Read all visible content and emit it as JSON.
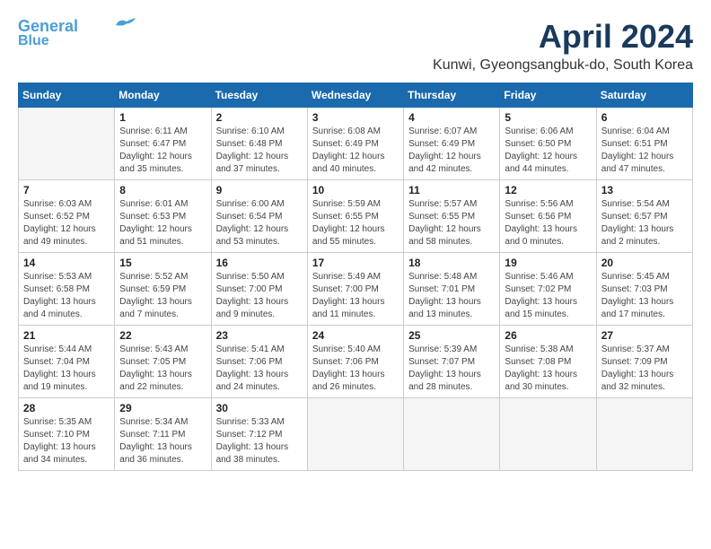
{
  "header": {
    "logo_line1": "General",
    "logo_line2": "Blue",
    "month_title": "April 2024",
    "subtitle": "Kunwi, Gyeongsangbuk-do, South Korea"
  },
  "weekdays": [
    "Sunday",
    "Monday",
    "Tuesday",
    "Wednesday",
    "Thursday",
    "Friday",
    "Saturday"
  ],
  "weeks": [
    [
      {
        "day": "",
        "info": ""
      },
      {
        "day": "1",
        "info": "Sunrise: 6:11 AM\nSunset: 6:47 PM\nDaylight: 12 hours\nand 35 minutes."
      },
      {
        "day": "2",
        "info": "Sunrise: 6:10 AM\nSunset: 6:48 PM\nDaylight: 12 hours\nand 37 minutes."
      },
      {
        "day": "3",
        "info": "Sunrise: 6:08 AM\nSunset: 6:49 PM\nDaylight: 12 hours\nand 40 minutes."
      },
      {
        "day": "4",
        "info": "Sunrise: 6:07 AM\nSunset: 6:49 PM\nDaylight: 12 hours\nand 42 minutes."
      },
      {
        "day": "5",
        "info": "Sunrise: 6:06 AM\nSunset: 6:50 PM\nDaylight: 12 hours\nand 44 minutes."
      },
      {
        "day": "6",
        "info": "Sunrise: 6:04 AM\nSunset: 6:51 PM\nDaylight: 12 hours\nand 47 minutes."
      }
    ],
    [
      {
        "day": "7",
        "info": "Sunrise: 6:03 AM\nSunset: 6:52 PM\nDaylight: 12 hours\nand 49 minutes."
      },
      {
        "day": "8",
        "info": "Sunrise: 6:01 AM\nSunset: 6:53 PM\nDaylight: 12 hours\nand 51 minutes."
      },
      {
        "day": "9",
        "info": "Sunrise: 6:00 AM\nSunset: 6:54 PM\nDaylight: 12 hours\nand 53 minutes."
      },
      {
        "day": "10",
        "info": "Sunrise: 5:59 AM\nSunset: 6:55 PM\nDaylight: 12 hours\nand 55 minutes."
      },
      {
        "day": "11",
        "info": "Sunrise: 5:57 AM\nSunset: 6:55 PM\nDaylight: 12 hours\nand 58 minutes."
      },
      {
        "day": "12",
        "info": "Sunrise: 5:56 AM\nSunset: 6:56 PM\nDaylight: 13 hours\nand 0 minutes."
      },
      {
        "day": "13",
        "info": "Sunrise: 5:54 AM\nSunset: 6:57 PM\nDaylight: 13 hours\nand 2 minutes."
      }
    ],
    [
      {
        "day": "14",
        "info": "Sunrise: 5:53 AM\nSunset: 6:58 PM\nDaylight: 13 hours\nand 4 minutes."
      },
      {
        "day": "15",
        "info": "Sunrise: 5:52 AM\nSunset: 6:59 PM\nDaylight: 13 hours\nand 7 minutes."
      },
      {
        "day": "16",
        "info": "Sunrise: 5:50 AM\nSunset: 7:00 PM\nDaylight: 13 hours\nand 9 minutes."
      },
      {
        "day": "17",
        "info": "Sunrise: 5:49 AM\nSunset: 7:00 PM\nDaylight: 13 hours\nand 11 minutes."
      },
      {
        "day": "18",
        "info": "Sunrise: 5:48 AM\nSunset: 7:01 PM\nDaylight: 13 hours\nand 13 minutes."
      },
      {
        "day": "19",
        "info": "Sunrise: 5:46 AM\nSunset: 7:02 PM\nDaylight: 13 hours\nand 15 minutes."
      },
      {
        "day": "20",
        "info": "Sunrise: 5:45 AM\nSunset: 7:03 PM\nDaylight: 13 hours\nand 17 minutes."
      }
    ],
    [
      {
        "day": "21",
        "info": "Sunrise: 5:44 AM\nSunset: 7:04 PM\nDaylight: 13 hours\nand 19 minutes."
      },
      {
        "day": "22",
        "info": "Sunrise: 5:43 AM\nSunset: 7:05 PM\nDaylight: 13 hours\nand 22 minutes."
      },
      {
        "day": "23",
        "info": "Sunrise: 5:41 AM\nSunset: 7:06 PM\nDaylight: 13 hours\nand 24 minutes."
      },
      {
        "day": "24",
        "info": "Sunrise: 5:40 AM\nSunset: 7:06 PM\nDaylight: 13 hours\nand 26 minutes."
      },
      {
        "day": "25",
        "info": "Sunrise: 5:39 AM\nSunset: 7:07 PM\nDaylight: 13 hours\nand 28 minutes."
      },
      {
        "day": "26",
        "info": "Sunrise: 5:38 AM\nSunset: 7:08 PM\nDaylight: 13 hours\nand 30 minutes."
      },
      {
        "day": "27",
        "info": "Sunrise: 5:37 AM\nSunset: 7:09 PM\nDaylight: 13 hours\nand 32 minutes."
      }
    ],
    [
      {
        "day": "28",
        "info": "Sunrise: 5:35 AM\nSunset: 7:10 PM\nDaylight: 13 hours\nand 34 minutes."
      },
      {
        "day": "29",
        "info": "Sunrise: 5:34 AM\nSunset: 7:11 PM\nDaylight: 13 hours\nand 36 minutes."
      },
      {
        "day": "30",
        "info": "Sunrise: 5:33 AM\nSunset: 7:12 PM\nDaylight: 13 hours\nand 38 minutes."
      },
      {
        "day": "",
        "info": ""
      },
      {
        "day": "",
        "info": ""
      },
      {
        "day": "",
        "info": ""
      },
      {
        "day": "",
        "info": ""
      }
    ]
  ]
}
